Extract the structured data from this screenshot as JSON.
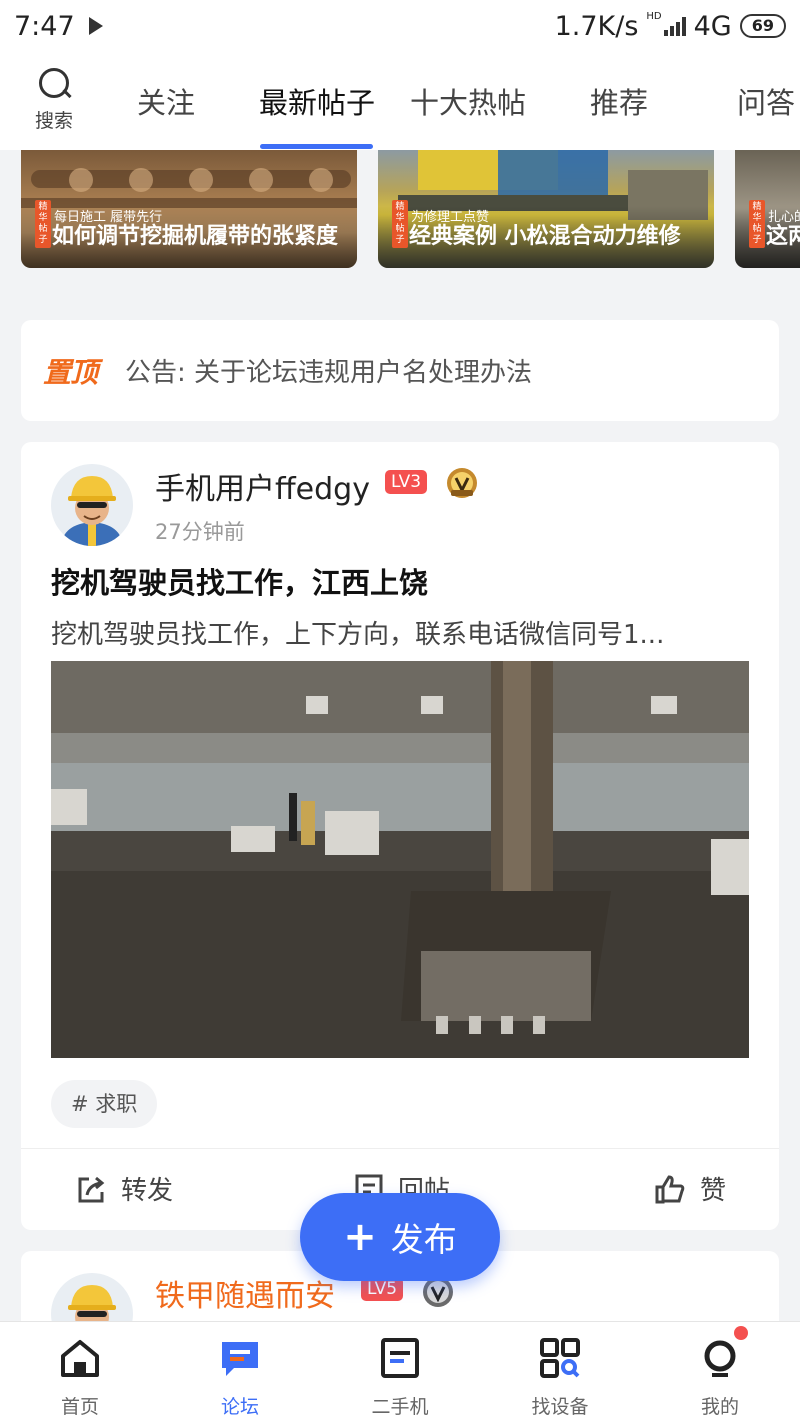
{
  "status_bar": {
    "time": "7:47",
    "speed": "1.7K/s",
    "hd": "HD",
    "network": "4G",
    "battery": "69"
  },
  "top_nav": {
    "search_label": "搜索",
    "tabs": [
      {
        "label": "关注",
        "active": false
      },
      {
        "label": "最新帖子",
        "active": true
      },
      {
        "label": "十大热帖",
        "active": false
      },
      {
        "label": "推荐",
        "active": false
      },
      {
        "label": "问答",
        "active": false
      }
    ],
    "accent_color": "#3d6ef6"
  },
  "banners": [
    {
      "tag": "精华帖子",
      "subtitle": "每日施工 履带先行",
      "title": "如何调节挖掘机履带的张紧度"
    },
    {
      "tag": "精华帖子",
      "subtitle": "为修理工点赞",
      "title": "经典案例 小松混合动力维修"
    },
    {
      "tag": "精华帖子",
      "subtitle": "扎心的",
      "title": "这两"
    }
  ],
  "notice": {
    "pin_label": "置顶",
    "text": "公告: 关于论坛违规用户名处理办法"
  },
  "post": {
    "username": "手机用户ffedgy",
    "level": "LV3",
    "medal_icon": "v2-medal-icon",
    "time": "27分钟前",
    "title": "挖机驾驶员找工作，江西上饶",
    "body": "挖机驾驶员找工作，上下方向，联系电话微信同号1...",
    "topic": "# 求职",
    "actions": {
      "share": "转发",
      "reply": "回帖",
      "like": "赞"
    }
  },
  "post2": {
    "username": "铁甲随遇而安",
    "level": "LV5",
    "medal_icon": "v3-medal-icon"
  },
  "fab": {
    "label": "发布"
  },
  "bottom_nav": [
    {
      "label": "首页",
      "icon": "home-icon",
      "active": false
    },
    {
      "label": "论坛",
      "icon": "forum-icon",
      "active": true
    },
    {
      "label": "二手机",
      "icon": "used-machine-icon",
      "active": false
    },
    {
      "label": "找设备",
      "icon": "find-equipment-icon",
      "active": false
    },
    {
      "label": "我的",
      "icon": "profile-icon",
      "active": false
    }
  ]
}
